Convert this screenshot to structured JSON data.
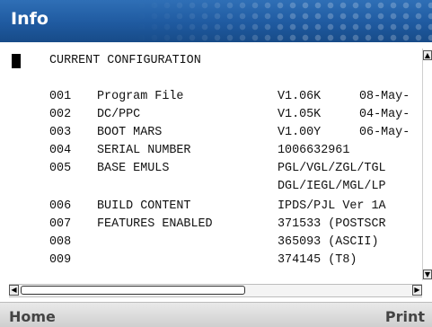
{
  "header": {
    "title": "Info"
  },
  "config": {
    "heading": "CURRENT CONFIGURATION",
    "rows": [
      {
        "num": "001",
        "name": "Program File",
        "value": "V1.06K",
        "date": "08-May-"
      },
      {
        "num": "002",
        "name": "DC/PPC",
        "value": "V1.05K",
        "date": "04-May-"
      },
      {
        "num": "003",
        "name": "BOOT MARS",
        "value": "V1.00Y",
        "date": "06-May-"
      },
      {
        "num": "004",
        "name": "SERIAL NUMBER",
        "value": "1006632961",
        "date": ""
      },
      {
        "num": "005",
        "name": "BASE EMULS",
        "value": "PGL/VGL/ZGL/TGL",
        "date": ""
      },
      {
        "num": "",
        "name": "",
        "value": "DGL/IEGL/MGL/LP",
        "date": ""
      },
      {
        "num": "006",
        "name": "BUILD CONTENT",
        "value": "IPDS/PJL Ver 1A",
        "date": ""
      },
      {
        "num": "007",
        "name": "FEATURES ENABLED",
        "value": "371533 (POSTSCR",
        "date": ""
      },
      {
        "num": "008",
        "name": "",
        "value": "365093 (ASCII)",
        "date": ""
      },
      {
        "num": "009",
        "name": "",
        "value": "374145 (T8)",
        "date": ""
      }
    ]
  },
  "softkeys": {
    "left": "Home",
    "right": "Print"
  },
  "icons": {
    "scroll_up": "scroll-up-arrow-icon",
    "scroll_down": "scroll-down-arrow-icon",
    "scroll_left": "scroll-left-arrow-icon",
    "scroll_right": "scroll-right-arrow-icon"
  },
  "colors": {
    "titlebar": "#1f5aa0",
    "title_text": "#ffffff",
    "softkey_text": "#444444"
  }
}
